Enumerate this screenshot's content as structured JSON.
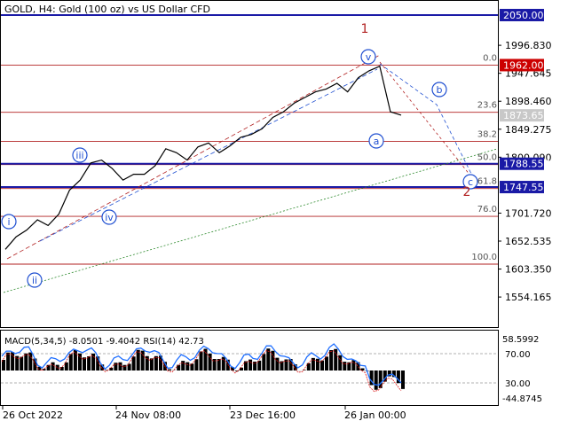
{
  "header": {
    "title": "GOLD, H4:  Gold (100 oz) vs US Dollar CFD"
  },
  "main_panel": {
    "y_ticks": [
      "1996.830",
      "1947.645",
      "1898.460",
      "1849.275",
      "1800.090",
      "1701.720",
      "1652.535",
      "1603.350",
      "1554.165"
    ],
    "price_tags": [
      {
        "label": "2050.000",
        "value": 2050.0,
        "style": "blue"
      },
      {
        "label": "1962.000",
        "value": 1962.0,
        "style": "red"
      },
      {
        "label": "1873.650",
        "value": 1873.65,
        "style": "grey"
      },
      {
        "label": "1788.557",
        "value": 1788.557,
        "style": "blue"
      },
      {
        "label": "1747.550",
        "value": 1747.55,
        "style": "blue"
      }
    ],
    "fib_levels": [
      {
        "label": "0.0",
        "value": 1962.0
      },
      {
        "label": "23.6",
        "value": 1879.0
      },
      {
        "label": "38.2",
        "value": 1828.0
      },
      {
        "label": "50.0",
        "value": 1787.0
      },
      {
        "label": "61.8",
        "value": 1745.0
      },
      {
        "label": "76.0",
        "value": 1696.0
      },
      {
        "label": "100.0",
        "value": 1612.0
      }
    ],
    "wave_labels": [
      {
        "text": "i",
        "kind": "circle"
      },
      {
        "text": "ii",
        "kind": "circle"
      },
      {
        "text": "iii",
        "kind": "circle"
      },
      {
        "text": "iv",
        "kind": "circle"
      },
      {
        "text": "v",
        "kind": "circle"
      },
      {
        "text": "a",
        "kind": "circle"
      },
      {
        "text": "b",
        "kind": "circle"
      },
      {
        "text": "c",
        "kind": "circle"
      },
      {
        "text": "1",
        "kind": "plain"
      },
      {
        "text": "2",
        "kind": "plain"
      }
    ],
    "colors": {
      "fib_red": "#b22222",
      "level_blue": "#1a1aa6",
      "wave_blue": "#1f4fd1",
      "trend_green": "#2e8b2e",
      "tag_grey": "#c8c8c8"
    }
  },
  "indicator_panel": {
    "label": "MACD(5,34,5) -8.0501 -9.4042 RSI(14) 42.73",
    "y_ticks": [
      "58.5992",
      "70.00",
      "30.00",
      "-44.8745"
    ]
  },
  "x_axis": {
    "ticks": [
      "26 Oct 2022",
      "24 Nov 08:00",
      "23 Dec 16:00",
      "26 Jan 00:00"
    ]
  },
  "chart_data": {
    "type": "line",
    "title": "GOLD, H4:  Gold (100 oz) vs US Dollar CFD",
    "x": [
      "26 Oct 2022",
      "24 Nov 08:00",
      "23 Dec 16:00",
      "26 Jan 00:00"
    ],
    "series": [
      {
        "values": [
          1638,
          1660,
          1672,
          1690,
          1680,
          1700,
          1742,
          1760,
          1790,
          1795,
          1780,
          1760,
          1770,
          1770,
          1785,
          1815,
          1808,
          1795,
          1818,
          1825,
          1808,
          1820,
          1835,
          1840,
          1850,
          1870,
          1880,
          1895,
          1905,
          1915,
          1920,
          1930,
          1915,
          1940,
          1952,
          1960,
          1880,
          1874
        ]
      }
    ],
    "ylim": [
      1530,
      2060
    ],
    "indicator": {
      "macd": {
        "value": -8.0501,
        "signal": -9.4042
      },
      "rsi": 42.73,
      "ylim": [
        -44.8745,
        58.5992
      ]
    }
  }
}
